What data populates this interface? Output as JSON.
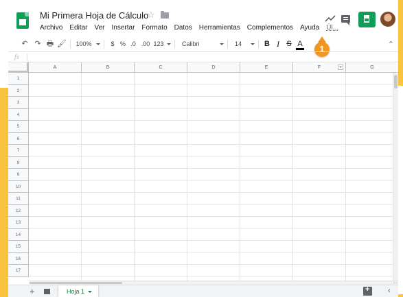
{
  "header": {
    "title": "Mi Primera Hoja de Cálculo",
    "star_glyph": "☆"
  },
  "menu": [
    "Archivo",
    "Editar",
    "Ver",
    "Insertar",
    "Formato",
    "Datos",
    "Herramientas",
    "Complementos",
    "Ayuda",
    "Úl..."
  ],
  "callout": {
    "number": "1",
    "color": "#f29620"
  },
  "toolbar": {
    "undo": "↶",
    "redo": "↷",
    "print": "🖶",
    "paint_format": "🖌",
    "zoom": "100%",
    "currency": "$",
    "percent": "%",
    "decrease_decimals": ".0",
    "increase_decimals": ".00",
    "more_formats": "123",
    "font": "Calibri",
    "font_size": "14",
    "bold": "B",
    "italic": "I",
    "strikethrough": "S",
    "text_color": "A",
    "collapse": "⌃"
  },
  "formula_bar": {
    "fx": "fx"
  },
  "columns": [
    "A",
    "B",
    "C",
    "D",
    "E",
    "F",
    "G"
  ],
  "rows": [
    "1",
    "2",
    "3",
    "4",
    "5",
    "6",
    "7",
    "8",
    "9",
    "10",
    "11",
    "12",
    "13",
    "14",
    "15",
    "16",
    "17"
  ],
  "sheets": {
    "add": "+",
    "active_tab": "Hoja 1",
    "side_toggle": "‹"
  },
  "scroll_arrows": "‹ ›",
  "colors": {
    "accent_yellow": "#f9c440",
    "sheets_green": "#0f9d58",
    "tab_text_green": "#188038"
  },
  "icons": [
    "sheets-logo",
    "star-icon",
    "folder-icon",
    "trend-icon",
    "comment-icon",
    "present-icon",
    "avatar"
  ]
}
